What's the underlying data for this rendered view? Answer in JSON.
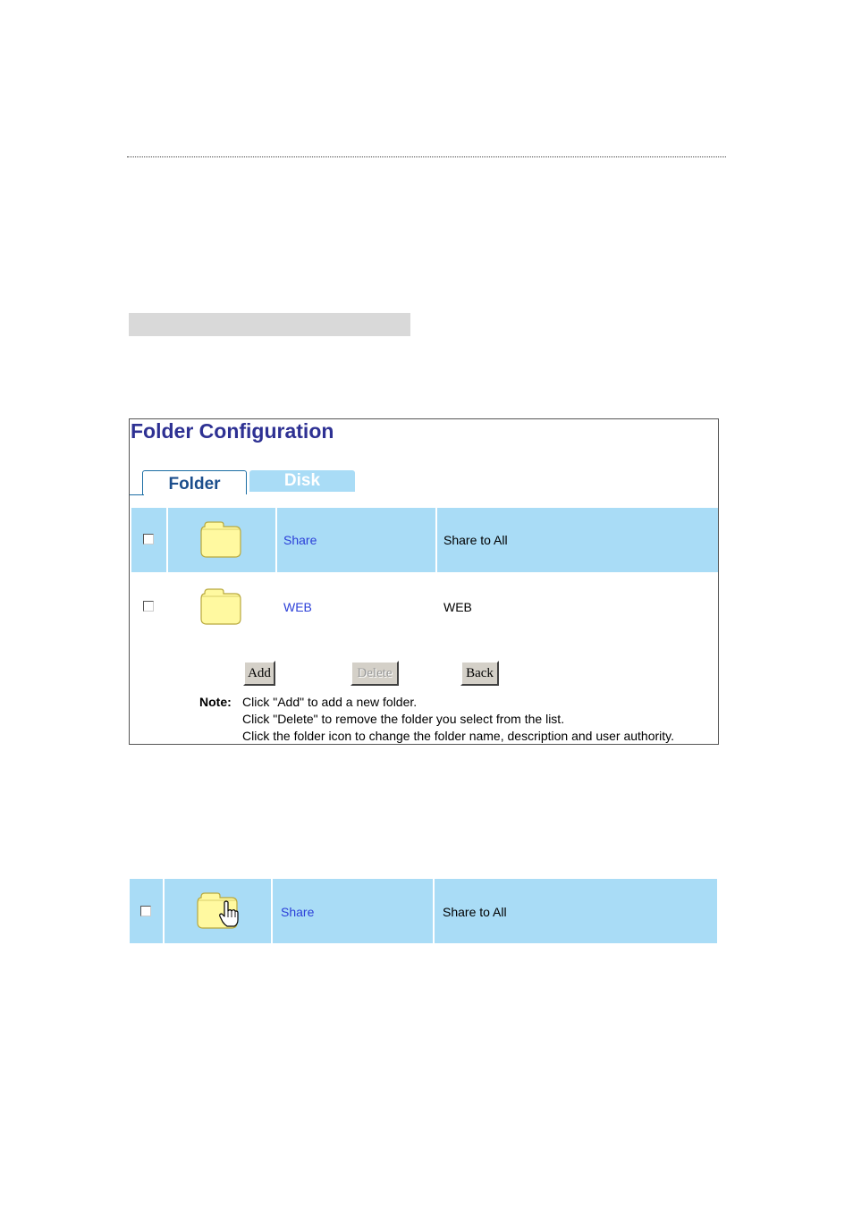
{
  "panel": {
    "title": "Folder Configuration",
    "tabs": [
      {
        "label": "Folder",
        "active": true
      },
      {
        "label": "Disk",
        "active": false
      }
    ],
    "rows": [
      {
        "name": "Share",
        "description": "Share to All",
        "checked": false,
        "highlighted": true
      },
      {
        "name": "WEB",
        "description": "WEB",
        "checked": false,
        "highlighted": false
      }
    ],
    "buttons": {
      "add": "Add",
      "delete": "Delete",
      "back": "Back"
    },
    "note": {
      "label": "Note:",
      "lines": [
        "Click \"Add\" to add a new folder.",
        "Click \"Delete\" to remove the folder you select from the list.",
        "Click the folder icon to change the folder name, description and user authority."
      ]
    }
  },
  "detail_row": {
    "name": "Share",
    "description": "Share to All",
    "checked": false
  },
  "colors": {
    "title": "#2e3193",
    "row_highlight": "#a9dcf6",
    "link": "#2b3fd8",
    "folder_fill": "#fff9a0",
    "folder_stroke": "#b8a83c"
  },
  "icons": {
    "folder": "folder-icon",
    "cursor": "hand-pointer-icon"
  }
}
